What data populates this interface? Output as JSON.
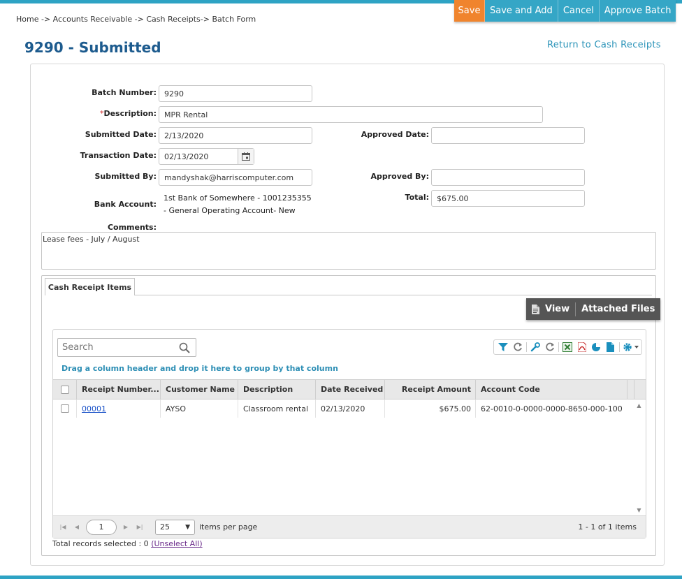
{
  "breadcrumb": "Home -> Accounts Receivable -> Cash Receipts-> Batch Form",
  "actions": {
    "save": "Save",
    "save_and_add": "Save and Add",
    "cancel": "Cancel",
    "approve_batch": "Approve Batch"
  },
  "page": {
    "title": "9290 - Submitted",
    "return_link": "Return to Cash Receipts"
  },
  "form": {
    "batch_number_label": "Batch Number:",
    "batch_number": "9290",
    "description_required": "*",
    "description_label": "Description:",
    "description": "MPR Rental",
    "submitted_date_label": "Submitted Date:",
    "submitted_date": "2/13/2020",
    "approved_date_label": "Approved Date:",
    "approved_date": "",
    "transaction_date_label": "Transaction Date:",
    "transaction_date": "02/13/2020",
    "submitted_by_label": "Submitted By:",
    "submitted_by": "mandyshak@harriscomputer.com",
    "approved_by_label": "Approved By:",
    "approved_by": "",
    "bank_account_label": "Bank Account:",
    "bank_account_line1": "1st Bank of Somewhere - 1001235355",
    "bank_account_line2": "- General Operating Account- New",
    "total_label": "Total:",
    "total": "$675.00",
    "comments_label": "Comments:",
    "comments": "Lease fees - July / August"
  },
  "tabs": {
    "cash_receipt_items": "Cash Receipt Items"
  },
  "toolbar": {
    "view": "View",
    "attached_files": "Attached Files"
  },
  "grid": {
    "search_placeholder": "Search",
    "group_hint": "Drag a column header and drop it here to group by that column",
    "columns": {
      "receipt_number": "Receipt Number...",
      "customer_name": "Customer Name",
      "description": "Description",
      "date_received": "Date Received",
      "receipt_amount": "Receipt Amount",
      "account_code": "Account Code"
    },
    "rows": [
      {
        "receipt_number": "00001",
        "customer_name": "AYSO",
        "description": "Classroom rental",
        "date_received": "02/13/2020",
        "receipt_amount": "$675.00",
        "account_code": "62-0010-0-0000-0000-8650-000-100"
      }
    ]
  },
  "pager": {
    "page": "1",
    "page_size": "25",
    "items_per_page": "items per page",
    "range": "1 - 1 of 1 items"
  },
  "selection": {
    "total_records_selected": "Total records selected : 0",
    "unselect_all": "(Unselect All)"
  },
  "colors": {
    "accent": "#35a6c6",
    "save": "#f0842d",
    "title": "#1d5b8e",
    "dark_toolbar": "#555555"
  },
  "icons": [
    "search-icon",
    "calendar-icon",
    "filter-icon",
    "refresh-icon",
    "wrench-icon",
    "excel-icon",
    "pdf-icon",
    "chart-icon",
    "document-icon",
    "gear-icon",
    "file-icon"
  ]
}
